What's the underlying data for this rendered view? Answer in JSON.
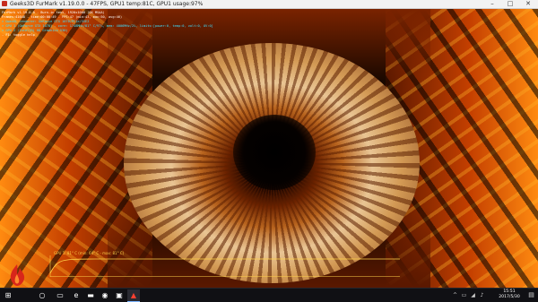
{
  "window": {
    "title": "Geeks3D FurMark v1.19.0.0 - 47FPS, GPU1 temp:81C, GPU1 usage:97%",
    "min_glyph": "–",
    "max_glyph": "□",
    "close_glyph": "✕"
  },
  "osd": {
    "lines": [
      "FurMark v1.19.0.0 - Burn-in test, 1920x1080 (0X MSAA)",
      "Frames:41648 - time:00:00:49 - FPS:47 (min:43, max:50, avg:46)",
      "> OpenGL renderer: GeForce GTX 1070/PCIe/SSE2",
      "> GPU 1 (GeForce GTX 1070) - core: 1748MHz/81° C/97%, mem: 4006MHz/2%, limits:[power:0, temp:0, volt:0, OV:0]",
      "> GPU 2 (Intel(R) HD Graphics 530)",
      "- F1: toggle help"
    ]
  },
  "graph": {
    "label": "GPU 1: 81° C (min: 64° C - max: 81° C)",
    "line_color": "#ffd24a"
  },
  "taskbar": {
    "items": [
      {
        "name": "start-icon",
        "glyph": "⊞",
        "active": false
      },
      {
        "name": "search-icon",
        "glyph": "○",
        "active": false
      },
      {
        "name": "task-view-icon",
        "glyph": "▭",
        "active": false
      },
      {
        "name": "edge-icon",
        "glyph": "e",
        "active": false
      },
      {
        "name": "file-explorer-icon",
        "glyph": "▬",
        "active": false
      },
      {
        "name": "chrome-icon",
        "glyph": "◉",
        "active": false
      },
      {
        "name": "store-icon",
        "glyph": "▣",
        "active": false
      },
      {
        "name": "furmark-icon",
        "glyph": "▲",
        "active": true
      }
    ],
    "tray": [
      "^",
      "▭",
      "◢",
      "♪"
    ],
    "clock_time": "15:51",
    "clock_date": "2017/5/30",
    "notif_glyph": "▤"
  },
  "colors": {
    "osd_gpu": "#3ee0ff",
    "furmark_brand": "#c62d1f"
  }
}
